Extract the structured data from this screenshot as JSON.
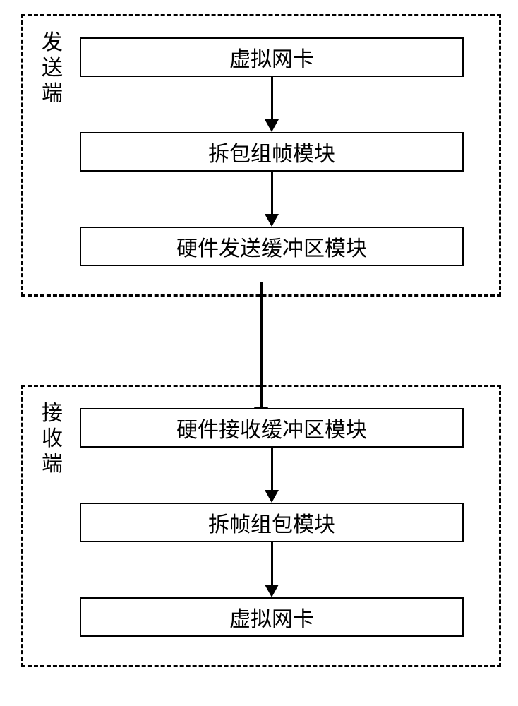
{
  "sender": {
    "label": "发送端",
    "boxes": [
      "虚拟网卡",
      "拆包组帧模块",
      "硬件发送缓冲区模块"
    ]
  },
  "receiver": {
    "label": "接收端",
    "boxes": [
      "硬件接收缓冲区模块",
      "拆帧组包模块",
      "虚拟网卡"
    ]
  }
}
